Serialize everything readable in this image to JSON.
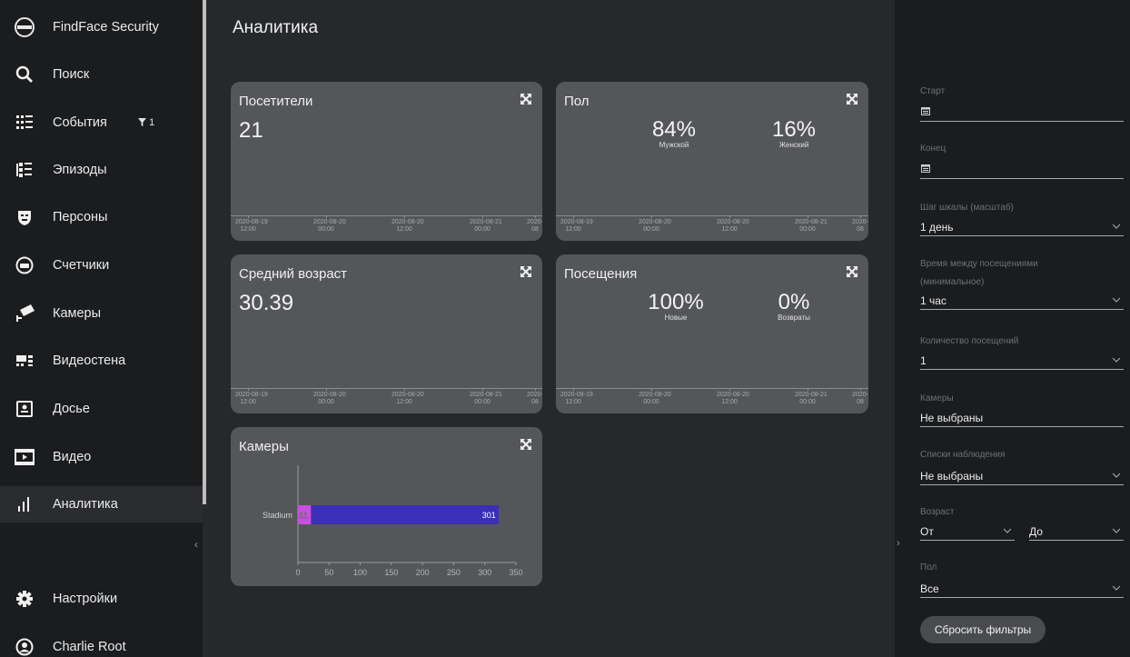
{
  "sidebar": {
    "brand": "FindFace Security",
    "items": [
      {
        "label": "Поиск",
        "icon": "search-icon"
      },
      {
        "label": "События",
        "icon": "events-icon",
        "badge": "1"
      },
      {
        "label": "Эпизоды",
        "icon": "episodes-icon"
      },
      {
        "label": "Персоны",
        "icon": "persons-icon"
      },
      {
        "label": "Счетчики",
        "icon": "counters-icon"
      },
      {
        "label": "Камеры",
        "icon": "camera-icon"
      },
      {
        "label": "Видеостена",
        "icon": "videowall-icon"
      },
      {
        "label": "Досье",
        "icon": "dossier-icon"
      },
      {
        "label": "Видео",
        "icon": "video-icon"
      },
      {
        "label": "Аналитика",
        "icon": "analytics-icon"
      }
    ],
    "settings": "Настройки",
    "user": "Charlie Root",
    "active_index": 9
  },
  "page": {
    "title": "Аналитика"
  },
  "date_ticks": [
    {
      "date": "2020-08-19",
      "time": "12:00"
    },
    {
      "date": "2020-08-20",
      "time": "00:00"
    },
    {
      "date": "2020-08-20",
      "time": "12:00"
    },
    {
      "date": "2020-08-21",
      "time": "00:00"
    },
    {
      "date": "2020-",
      "time": "08"
    }
  ],
  "cards": {
    "visitors": {
      "title": "Посетители",
      "value": "21"
    },
    "gender": {
      "title": "Пол",
      "a_value": "84%",
      "a_label": "Мужской",
      "b_value": "16%",
      "b_label": "Женский"
    },
    "age": {
      "title": "Средний возраст",
      "value": "30.39"
    },
    "visits": {
      "title": "Посещения",
      "a_value": "100%",
      "a_label": "Новые",
      "b_value": "0%",
      "b_label": "Возвраты"
    },
    "cameras": {
      "title": "Камеры"
    }
  },
  "chart_data": {
    "type": "bar",
    "orientation": "horizontal",
    "stacked": true,
    "categories": [
      "Stadium"
    ],
    "series": [
      {
        "values": [
          21
        ],
        "color": "#c84fe0"
      },
      {
        "values": [
          301
        ],
        "color": "#3a2fb6"
      }
    ],
    "xlim": [
      0,
      350
    ],
    "xticks": [
      0,
      50,
      100,
      150,
      200,
      250,
      300,
      350
    ]
  },
  "filters": {
    "start": {
      "label": "Старт",
      "value": ""
    },
    "end": {
      "label": "Конец",
      "value": ""
    },
    "scale": {
      "label": "Шаг шкалы (масштаб)",
      "value": "1 день"
    },
    "interval": {
      "label": "Время между посещениями",
      "label2": "(минимальное)",
      "value": "1 час"
    },
    "visits_count": {
      "label": "Количество посещений",
      "value": "1"
    },
    "cameras": {
      "label": "Камеры",
      "value": "Не выбраны"
    },
    "watchlists": {
      "label": "Списки наблюдения",
      "value": "Не выбраны"
    },
    "age": {
      "label": "Возраст",
      "from": "От",
      "to": "До"
    },
    "gender": {
      "label": "Пол",
      "value": "Все"
    },
    "reset": "Сбросить фильтры"
  }
}
